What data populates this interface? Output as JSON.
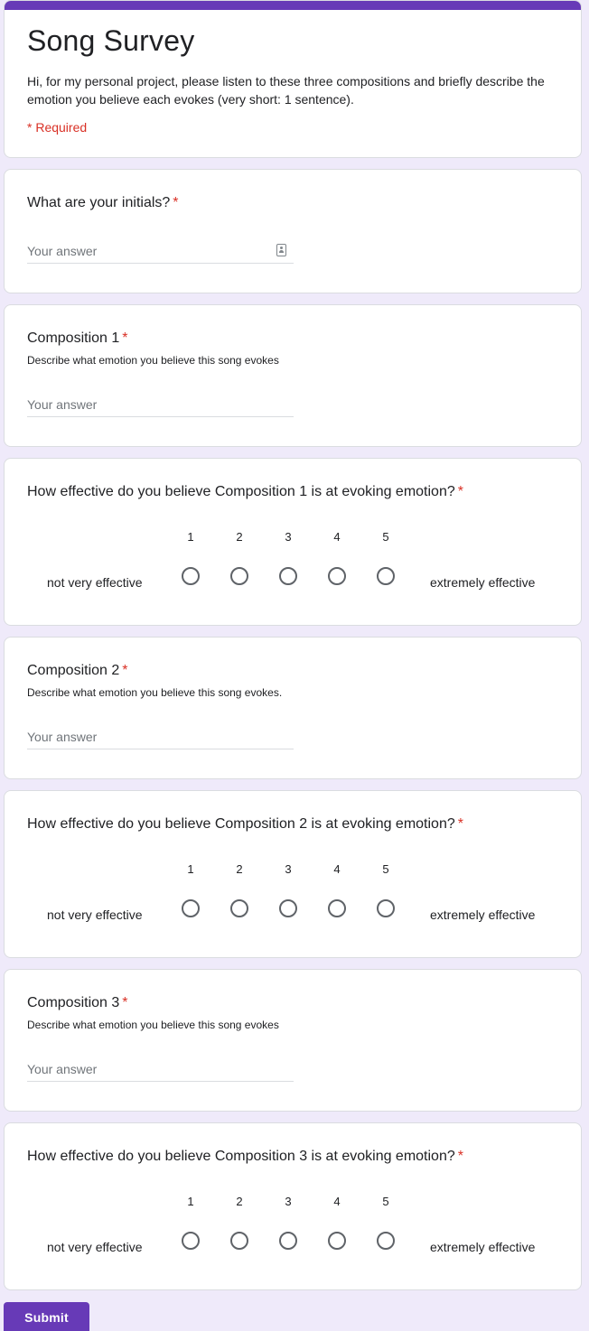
{
  "form": {
    "title": "Song Survey",
    "description": "Hi, for my personal project, please listen to these three compositions and briefly describe the emotion you believe each evokes (very short: 1 sentence).",
    "required_note": "* Required",
    "accent_color": "#673ab7",
    "required_color": "#d93025"
  },
  "questions": [
    {
      "title": "What are your initials?",
      "required_mark": "*",
      "placeholder": "Your answer",
      "icon": "contact-card-icon"
    },
    {
      "title": "Composition 1",
      "required_mark": "*",
      "description": "Describe what emotion you believe this song evokes",
      "placeholder": "Your answer"
    },
    {
      "title": "How effective do you believe Composition 1 is at evoking emotion?",
      "required_mark": "*",
      "scale": [
        "1",
        "2",
        "3",
        "4",
        "5"
      ],
      "low_label": "not very effective",
      "high_label": "extremely effective"
    },
    {
      "title": "Composition 2",
      "required_mark": "*",
      "description": "Describe what emotion you believe this song evokes.",
      "placeholder": "Your answer"
    },
    {
      "title": "How effective do you believe Composition 2 is at evoking emotion?",
      "required_mark": "*",
      "scale": [
        "1",
        "2",
        "3",
        "4",
        "5"
      ],
      "low_label": "not very effective",
      "high_label": "extremely effective"
    },
    {
      "title": "Composition 3",
      "required_mark": "*",
      "description": "Describe what emotion you believe this song evokes",
      "placeholder": "Your answer"
    },
    {
      "title": "How effective do you believe Composition 3 is at evoking emotion?",
      "required_mark": "*",
      "scale": [
        "1",
        "2",
        "3",
        "4",
        "5"
      ],
      "low_label": "not very effective",
      "high_label": "extremely effective"
    }
  ],
  "submit": {
    "label": "Submit"
  }
}
